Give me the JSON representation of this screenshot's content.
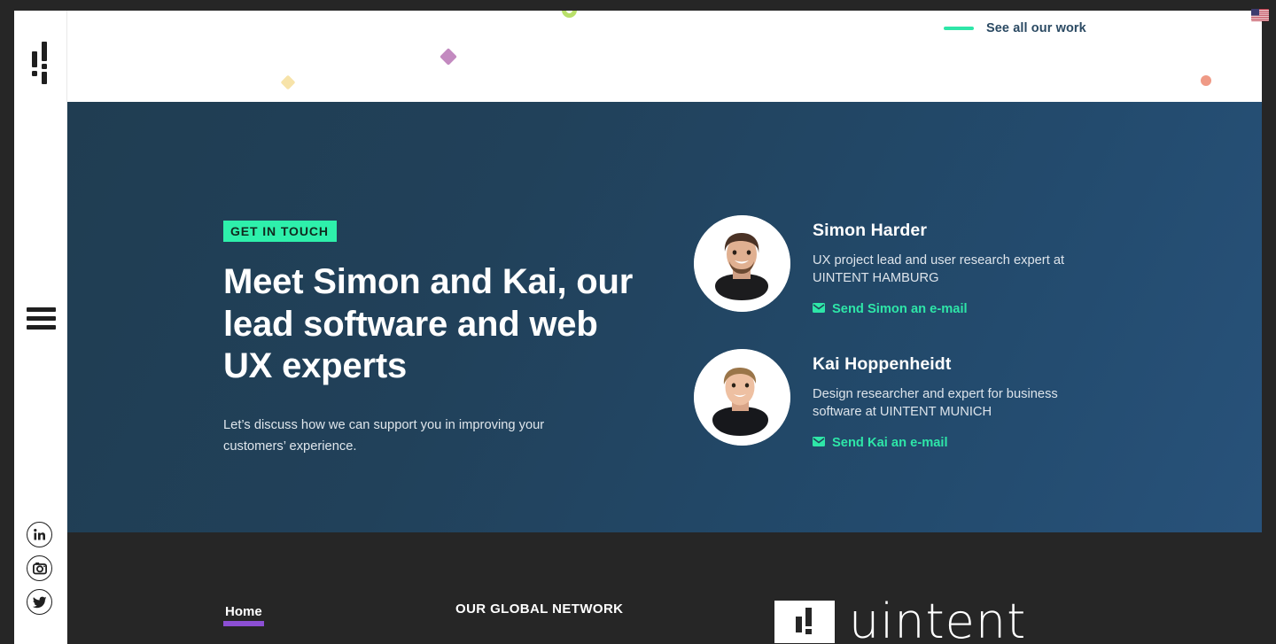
{
  "browser": {
    "locale_flag_icon": "us-flag-icon"
  },
  "rail": {
    "logo_icon": "uintent-mark-icon",
    "menu_icon": "hamburger-menu-icon",
    "social": [
      {
        "name": "linkedin",
        "icon": "linkedin-icon",
        "glyph": "in"
      },
      {
        "name": "instagram",
        "icon": "instagram-icon",
        "glyph": ""
      },
      {
        "name": "twitter",
        "icon": "twitter-icon",
        "glyph": ""
      }
    ]
  },
  "deco": {
    "shapes": [
      {
        "name": "green-ring",
        "icon": "ring-shape",
        "color": "#b9e06a"
      },
      {
        "name": "purple-diamond",
        "icon": "diamond-shape",
        "color": "#c38ac0"
      },
      {
        "name": "yellow-diamond",
        "icon": "diamond-shape",
        "color": "#f7e3a9"
      },
      {
        "name": "salmon-ring",
        "icon": "ring-shape",
        "color": "#ef9a86"
      }
    ]
  },
  "header": {
    "see_all_label": "See all our work",
    "accent_color": "#2ee6a8"
  },
  "hero": {
    "badge": "GET IN TOUCH",
    "badge_color": "#2ef0ab",
    "heading": "Meet Simon and Kai, our lead software and web UX experts",
    "paragraph": "Let’s discuss how we can support you in improving your customers’ experience.",
    "background_from": "#203d52",
    "background_to": "#28527a",
    "contacts": [
      {
        "name": "Simon Harder",
        "role": "UX project lead and user research expert at UINTENT HAMBURG",
        "email_label": "Send Simon an e-mail",
        "avatar_icon": "avatar-photo-simon",
        "mail_icon": "envelope-icon"
      },
      {
        "name": "Kai Hoppenheidt",
        "role": "Design researcher and expert for business software at UINTENT MUNICH",
        "email_label": "Send Kai an e-mail",
        "avatar_icon": "avatar-photo-kai",
        "mail_icon": "envelope-icon"
      }
    ]
  },
  "footer": {
    "home_label": "Home",
    "home_underline_color": "#8c4fd4",
    "network_heading": "OUR GLOBAL NETWORK",
    "brand_word": "uintent",
    "brand_mark_icon": "uintent-logo-icon",
    "background": "#262626"
  }
}
